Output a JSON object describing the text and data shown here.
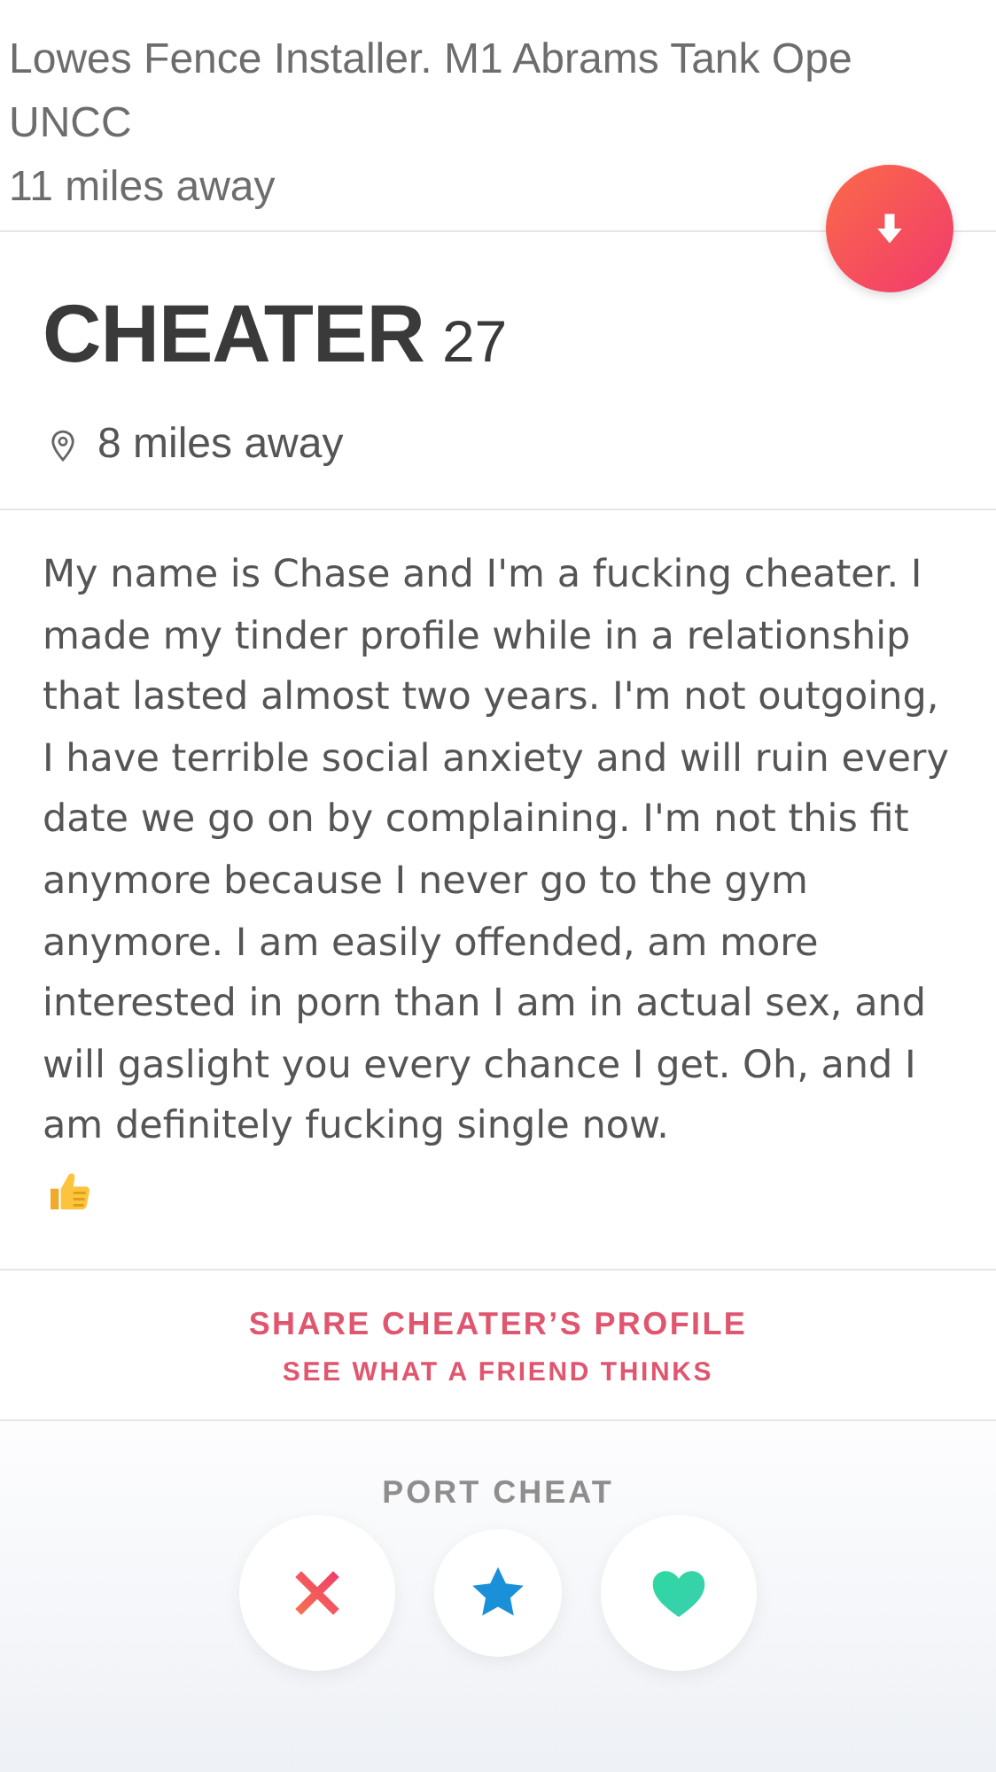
{
  "profile_header": {
    "lines": [
      "Lowes Fence Installer. M1 Abrams Tank Ope",
      "UNCC",
      "11 miles away"
    ]
  },
  "name": "CHEATER",
  "age": "27",
  "distance": "8 miles away",
  "bio": "My name is Chase and I'm a fucking cheater. I made my tinder profile while in a relationship that lasted almost two years. I'm not outgoing, I have terrible social anxiety and will ruin every date we go on by complaining. I'm not this fit anymore because I never go to the gym anymore. I am easily offended, am more interested in porn than I am in actual sex, and will gaslight you every chance I get. Oh, and I am definitely fucking single now.",
  "share": {
    "title": "SHARE CHEATER’S PROFILE",
    "subtitle": "SEE WHAT A FRIEND THINKS"
  },
  "report": "PORT CHEAT",
  "actions": [
    {
      "kind": "nope"
    },
    {
      "kind": "super_like"
    },
    {
      "kind": "like"
    }
  ]
}
